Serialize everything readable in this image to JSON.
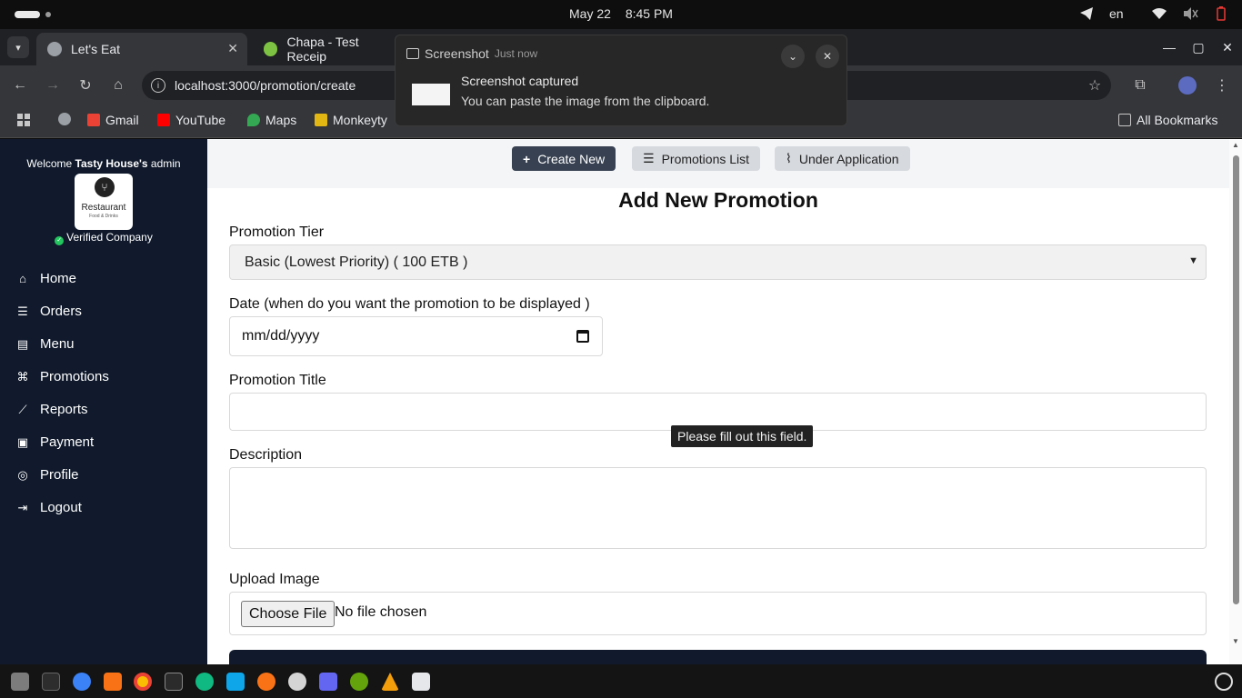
{
  "system": {
    "date": "May 22",
    "time": "8:45 PM",
    "language": "en"
  },
  "browser": {
    "tabs": [
      {
        "title": "Let's Eat",
        "active": true
      },
      {
        "title": "Chapa - Test Receip",
        "active": false
      }
    ],
    "url": "localhost:3000/promotion/create",
    "bookmarks": [
      "Gmail",
      "YouTube",
      "Maps",
      "Monkeyty"
    ],
    "all_bookmarks": "All Bookmarks"
  },
  "notification": {
    "app": "Screenshot",
    "time": "Just now",
    "title": "Screenshot captured",
    "message": "You can paste the image from the clipboard."
  },
  "sidebar": {
    "welcome_prefix": "Welcome",
    "restaurant_name": "Tasty House's",
    "welcome_suffix": "admin",
    "logo_text": "Restaurant",
    "logo_subtext": "Food & Drinks",
    "verified_label": "Verified Company",
    "items": [
      {
        "label": "Home",
        "icon": "home-icon"
      },
      {
        "label": "Orders",
        "icon": "list-icon"
      },
      {
        "label": "Menu",
        "icon": "book-icon"
      },
      {
        "label": "Promotions",
        "icon": "promo-icon"
      },
      {
        "label": "Reports",
        "icon": "chart-icon"
      },
      {
        "label": "Payment",
        "icon": "payment-icon"
      },
      {
        "label": "Profile",
        "icon": "user-icon"
      },
      {
        "label": "Logout",
        "icon": "logout-icon"
      }
    ]
  },
  "topnav": {
    "create_new": "Create New",
    "promotions_list": "Promotions List",
    "under_application": "Under Application"
  },
  "form": {
    "heading": "Add New Promotion",
    "tier_label": "Promotion Tier",
    "tier_value": "Basic (Lowest Priority) ( 100 ETB )",
    "date_label": "Date (when do you want the promotion to be displayed )",
    "date_placeholder": "mm/dd/yyyy",
    "title_label": "Promotion Title",
    "title_value": "",
    "tooltip": "Please fill out this field.",
    "description_label": "Description",
    "upload_label": "Upload Image",
    "choose_file": "Choose File",
    "no_file": "No file chosen"
  },
  "colors": {
    "sidebar_bg": "#101a2c",
    "primary_button": "#374151",
    "secondary_button": "#d6d9de",
    "verified": "#22c55e"
  }
}
